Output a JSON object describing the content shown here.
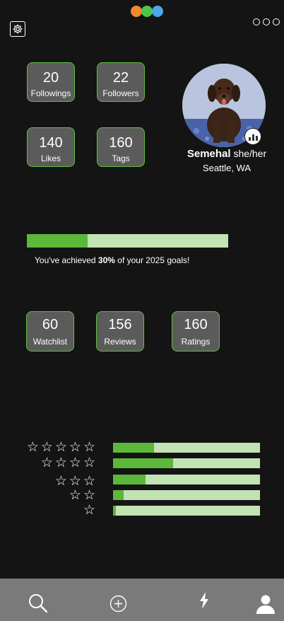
{
  "colors": {
    "dot1": "#f08a2c",
    "dot2": "#4ec44a",
    "dot3": "#49a8e8",
    "accent": "#5bb83a",
    "track": "#c2e3b4"
  },
  "header": {
    "settings_icon": "gear-icon",
    "more_icon": "more-dots-icon"
  },
  "stats_top": [
    {
      "value": "20",
      "label": "Followings"
    },
    {
      "value": "22",
      "label": "Followers"
    },
    {
      "value": "140",
      "label": "Likes"
    },
    {
      "value": "160",
      "label": "Tags"
    }
  ],
  "profile": {
    "name": "Semehal",
    "pronouns": "she/her",
    "location": "Seattle, WA",
    "badge_icon": "stats-badge-icon"
  },
  "goal": {
    "prefix": "You've achieved ",
    "percent_text": "30%",
    "suffix": " of your 2025 goals!",
    "progress": 0.3
  },
  "stats_mid": [
    {
      "value": "60",
      "label": "Watchlist"
    },
    {
      "value": "156",
      "label": "Reviews"
    },
    {
      "value": "160",
      "label": "Ratings"
    }
  ],
  "ratings": [
    {
      "stars": "☆☆☆☆☆",
      "fraction": 0.28
    },
    {
      "stars": "☆☆☆☆",
      "fraction": 0.41
    },
    {
      "stars": "☆☆☆",
      "fraction": 0.22
    },
    {
      "stars": "☆☆",
      "fraction": 0.07
    },
    {
      "stars": "☆",
      "fraction": 0.02
    }
  ],
  "nav": {
    "items": [
      "search-icon",
      "add-icon",
      "activity-icon",
      "profile-icon"
    ]
  }
}
